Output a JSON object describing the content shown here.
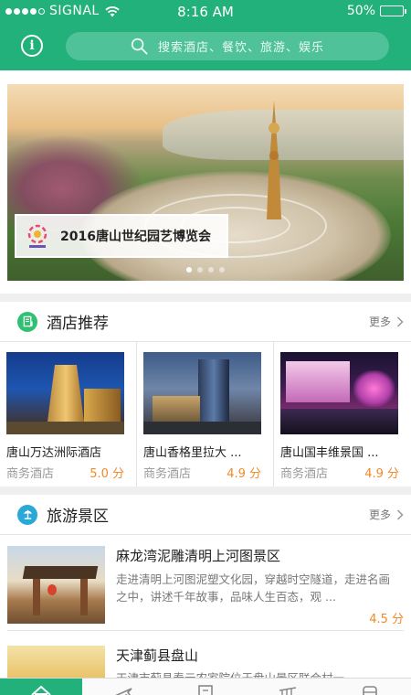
{
  "status_bar": {
    "carrier": "SIGNAL",
    "time": "8:16 AM",
    "battery": "50%",
    "battery_level": 0.5
  },
  "header": {
    "search_placeholder": "搜索酒店、餐饮、旅游、娱乐",
    "accent_color": "#22b07b"
  },
  "banner": {
    "caption": "2016唐山世纪园艺博览会",
    "page_count": 4,
    "active_page": 1
  },
  "hotels_section": {
    "title": "酒店推荐",
    "more_label": "更多",
    "items": [
      {
        "name": "唐山万达洲际酒店",
        "type": "商务酒店",
        "score": "5.0 分"
      },
      {
        "name": "唐山香格里拉大 ...",
        "type": "商务酒店",
        "score": "4.9 分"
      },
      {
        "name": "唐山国丰维景国 ...",
        "type": "商务酒店",
        "score": "4.9 分"
      }
    ]
  },
  "scenic_section": {
    "title": "旅游景区",
    "more_label": "更多",
    "items": [
      {
        "title": "麻龙湾泥雕清明上河图景区",
        "desc": "走进清明上河图泥塑文化园，穿越时空隧道，走进名画之中，讲述千年故事，品味人生百态，观 ...",
        "score": "4.5 分"
      },
      {
        "title": "天津蓟县盘山",
        "desc": "天津市蓟县春元农家院位于盘山景区联合村一...",
        "score": ""
      }
    ]
  },
  "tabbar": {
    "items": [
      "home-icon",
      "plane-icon",
      "building-icon",
      "train-icon",
      "bus-icon"
    ],
    "active_index": 0
  }
}
